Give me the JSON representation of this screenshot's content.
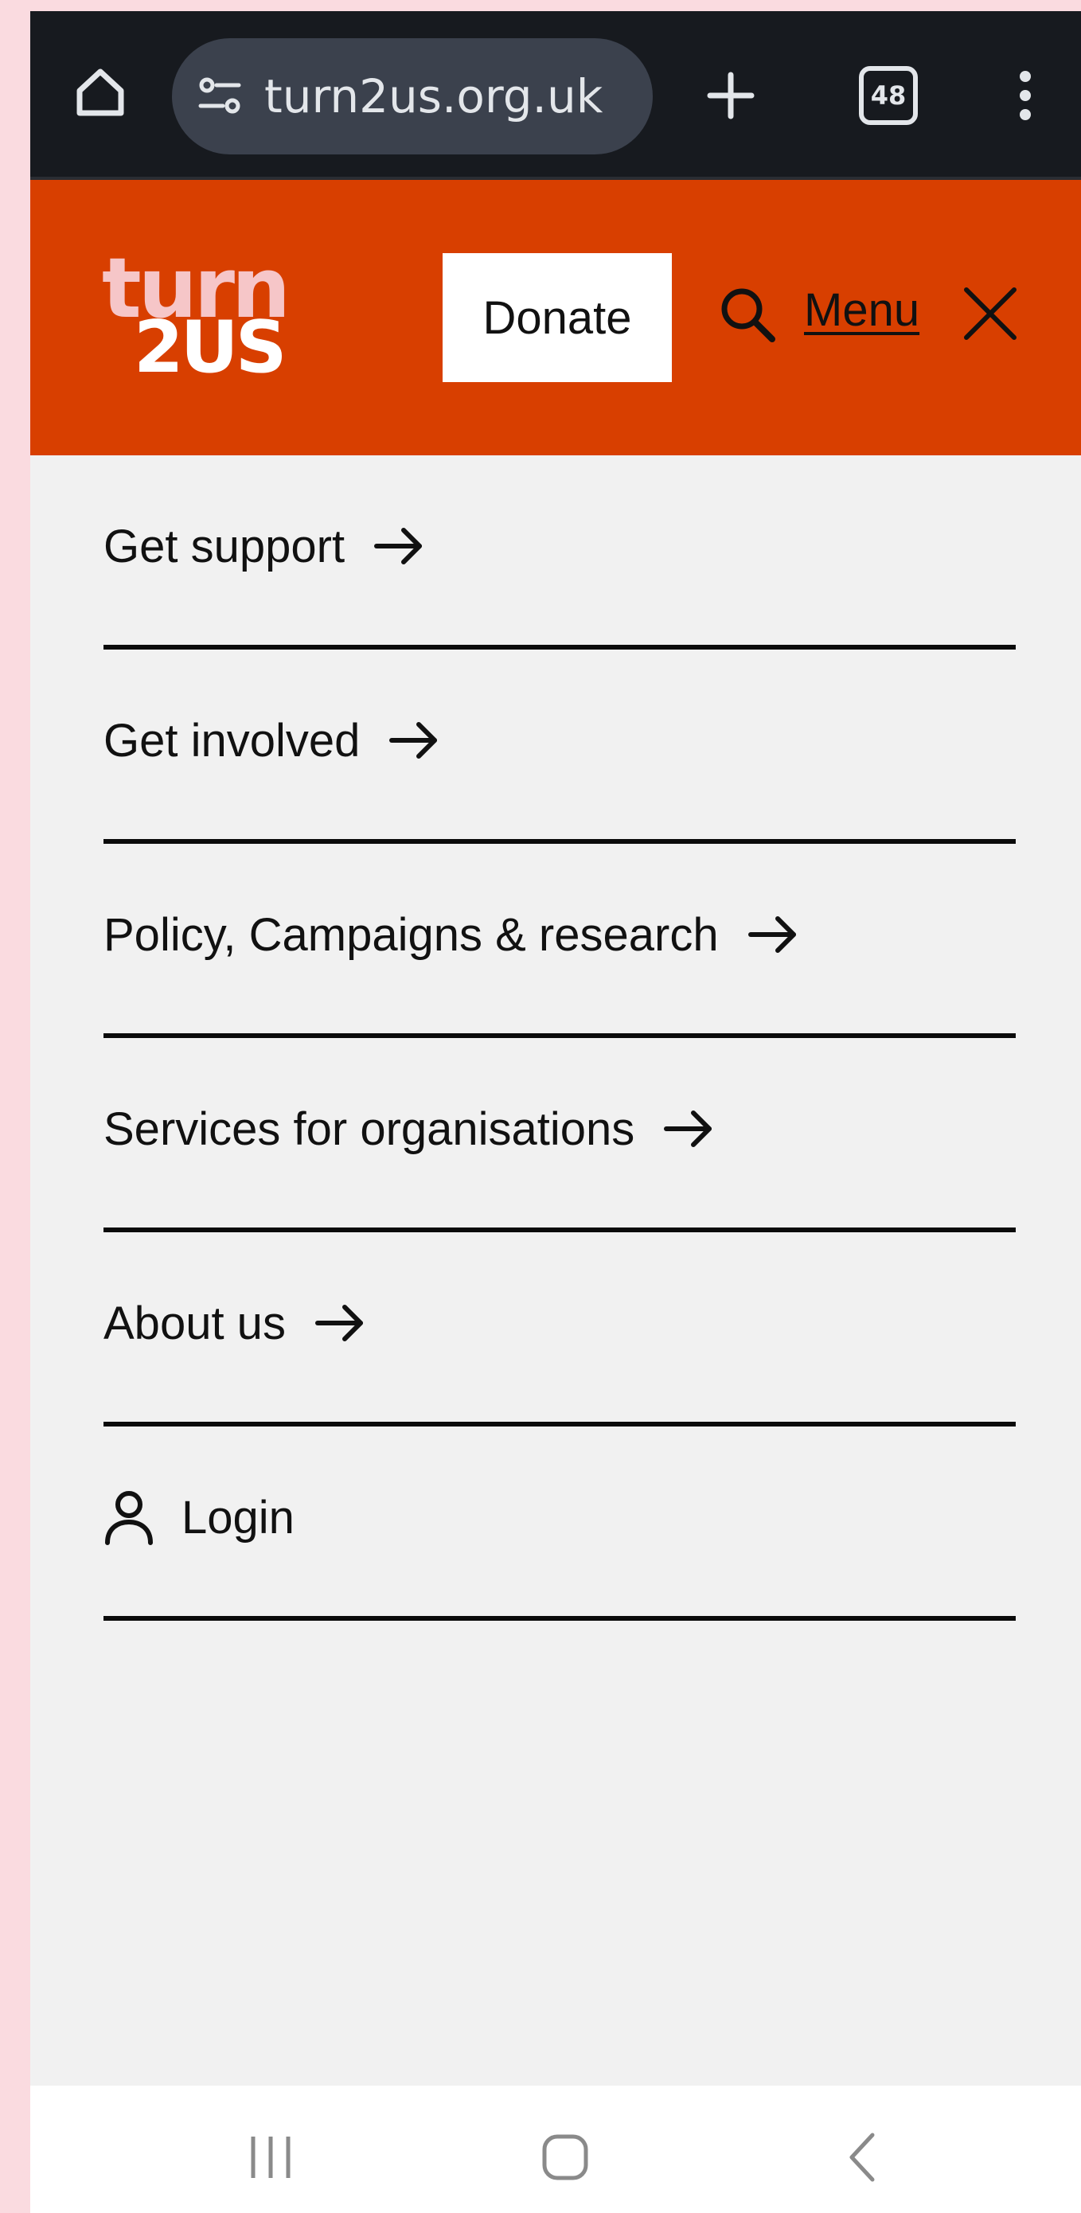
{
  "browser": {
    "url": "turn2us.org.uk",
    "tab_count": "48",
    "icons": {
      "home": "home-icon",
      "site_settings": "tune-icon",
      "new_tab": "plus-icon",
      "more": "more-vert-icon"
    }
  },
  "header": {
    "logo_line1": "turn",
    "logo_line2": "2US",
    "donate_label": "Donate",
    "menu_label": "Menu",
    "colors": {
      "background": "#d83f00",
      "logo_pink": "#f6c6c8"
    }
  },
  "menu": {
    "items": [
      {
        "label": "Get support",
        "icon": "arrow-right-icon"
      },
      {
        "label": "Get involved",
        "icon": "arrow-right-icon"
      },
      {
        "label": "Policy, Campaigns & research",
        "icon": "arrow-right-icon"
      },
      {
        "label": "Services for organisations",
        "icon": "arrow-right-icon"
      },
      {
        "label": "About us",
        "icon": "arrow-right-icon"
      }
    ],
    "login_label": "Login"
  },
  "system_nav": {
    "icons": [
      "recents-icon",
      "home-icon",
      "back-icon"
    ]
  }
}
